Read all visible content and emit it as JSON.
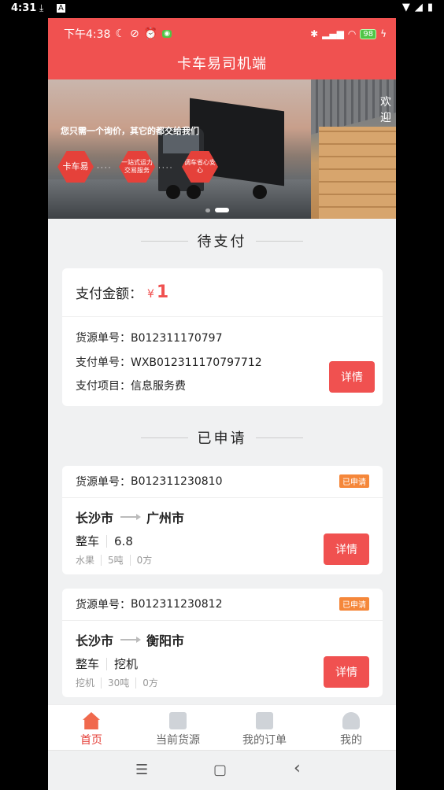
{
  "outer_status": {
    "time": "4:31",
    "download_icon": "download-icon",
    "a_icon": "A"
  },
  "inner_status": {
    "time": "下午4:38",
    "battery": "98"
  },
  "app": {
    "title": "卡车易司机端"
  },
  "banner": {
    "slogan": "您只需一个询价，其它的都交给我们",
    "hex1": "卡车易",
    "hex2": "一站式运力交易服务",
    "hex3": "调车省心安心",
    "slide2_text": "欢迎"
  },
  "pending": {
    "section_title": "待支付",
    "amount_label": "支付金额：",
    "currency": "¥",
    "amount": "1",
    "rows": [
      {
        "label": "货源单号：",
        "value": "B012311170797"
      },
      {
        "label": "支付单号：",
        "value": "WXB012311170797712"
      },
      {
        "label": "支付项目：",
        "value": "信息服务费"
      }
    ],
    "detail_button": "详情"
  },
  "applied": {
    "section_title": "已申请",
    "orders": [
      {
        "order_label": "货源单号：",
        "order_no": "B012311230810",
        "badge": "已申请",
        "from": "长沙市",
        "to": "广州市",
        "vehicle": "整车",
        "spec": "6.8",
        "goods": "水果",
        "weight": "5吨",
        "volume": "0方",
        "detail_button": "详情"
      },
      {
        "order_label": "货源单号：",
        "order_no": "B012311230812",
        "badge": "已申请",
        "from": "长沙市",
        "to": "衡阳市",
        "vehicle": "整车",
        "spec": "挖机",
        "goods": "挖机",
        "weight": "30吨",
        "volume": "0方",
        "detail_button": "详情"
      }
    ]
  },
  "tabbar": [
    {
      "label": "首页",
      "icon": "home-icon",
      "active": true
    },
    {
      "label": "当前货源",
      "icon": "box-icon",
      "active": false
    },
    {
      "label": "我的订单",
      "icon": "clipboard-icon",
      "active": false
    },
    {
      "label": "我的",
      "icon": "user-icon",
      "active": false
    }
  ],
  "navbar": {
    "menu": "☰",
    "home": "▢",
    "back": "‹"
  },
  "colors": {
    "brand": "#f05150",
    "badge": "#f5873a"
  }
}
